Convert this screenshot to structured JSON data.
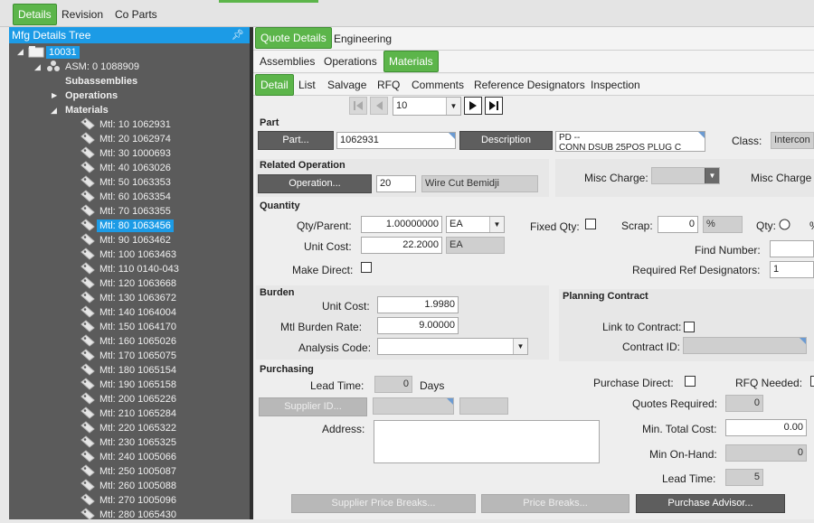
{
  "top_tabs": [
    "Details",
    "Revision",
    "Co Parts"
  ],
  "tree": {
    "title": "Mfg Details Tree",
    "root": "10031",
    "asm": "ASM: 0 1088909",
    "subassemblies": "Subassemblies",
    "operations": "Operations",
    "materials": "Materials",
    "items": [
      "Mtl: 10 1062931",
      "Mtl: 20 1062974",
      "Mtl: 30 1000693",
      "Mtl: 40 1063026",
      "Mtl: 50 1063353",
      "Mtl: 60 1063354",
      "Mtl: 70 1063355",
      "Mtl: 80 1063456",
      "Mtl: 90 1063462",
      "Mtl: 100 1063463",
      "Mtl: 110 0140-043",
      "Mtl: 120 1063668",
      "Mtl: 130 1063672",
      "Mtl: 140 1064004",
      "Mtl: 150 1064170",
      "Mtl: 160 1065026",
      "Mtl: 170 1065075",
      "Mtl: 180 1065154",
      "Mtl: 190 1065158",
      "Mtl: 200 1065226",
      "Mtl: 210 1065284",
      "Mtl: 220 1065322",
      "Mtl: 230 1065325",
      "Mtl: 240 1005066",
      "Mtl: 250 1005087",
      "Mtl: 260 1005088",
      "Mtl: 270 1005096",
      "Mtl: 280 1065430"
    ]
  },
  "main_tabs": [
    "Quote Details",
    "Engineering"
  ],
  "sub_tabs": [
    "Assemblies",
    "Operations",
    "Materials"
  ],
  "detail_tabs": [
    "Detail",
    "List",
    "Salvage",
    "RFQ",
    "Comments",
    "Reference Designators",
    "Inspection"
  ],
  "nav": {
    "value": "10"
  },
  "part": {
    "title": "Part",
    "part_btn": "Part...",
    "part_value": "1062931",
    "desc_btn": "Description",
    "desc_line1": "PD --",
    "desc_line2": "CONN DSUB 25POS PLUG C",
    "class_label": "Class:",
    "class_value": "Intercon"
  },
  "related_op": {
    "title": "Related Operation",
    "op_btn": "Operation...",
    "op_num": "20",
    "op_desc": "Wire Cut Bemidji",
    "misc_charge_label": "Misc Charge:",
    "misc_charge2_label": "Misc Charge"
  },
  "quantity": {
    "title": "Quantity",
    "qty_parent_label": "Qty/Parent:",
    "qty_parent_value": "1.00000000",
    "uom": "EA",
    "fixed_qty_label": "Fixed Qty:",
    "scrap_label": "Scrap:",
    "scrap_value": "0",
    "scrap_unit": "%",
    "qty_label": "Qty:",
    "pct": "%",
    "unit_cost_label": "Unit Cost:",
    "unit_cost_value": "22.2000",
    "unit_cost_uom": "EA",
    "find_number_label": "Find Number:",
    "make_direct_label": "Make Direct:",
    "req_ref_label": "Required Ref Designators:",
    "req_ref_value": "1"
  },
  "burden": {
    "title": "Burden",
    "unit_cost_label": "Unit Cost:",
    "unit_cost_value": "1.9980",
    "rate_label": "Mtl  Burden Rate:",
    "rate_value": "9.00000",
    "analysis_label": "Analysis Code:"
  },
  "planning": {
    "title": "Planning Contract",
    "link_label": "Link to Contract:",
    "contract_label": "Contract ID:"
  },
  "purchasing": {
    "title": "Purchasing",
    "lead_time_label": "Lead Time:",
    "lead_time_value": "0",
    "days": "Days",
    "supplier_btn": "Supplier ID...",
    "address_label": "Address:",
    "purchase_direct_label": "Purchase Direct:",
    "rfq_needed_label": "RFQ Needed:",
    "quotes_req_label": "Quotes Required:",
    "quotes_req_value": "0",
    "min_total_label": "Min. Total Cost:",
    "min_total_value": "0.00",
    "min_onhand_label": "Min On-Hand:",
    "min_onhand_value": "0",
    "lead_time2_label": "Lead Time:",
    "lead_time2_value": "5"
  },
  "bottom_buttons": [
    "Supplier Price Breaks...",
    "Price Breaks...",
    "Purchase Advisor..."
  ]
}
